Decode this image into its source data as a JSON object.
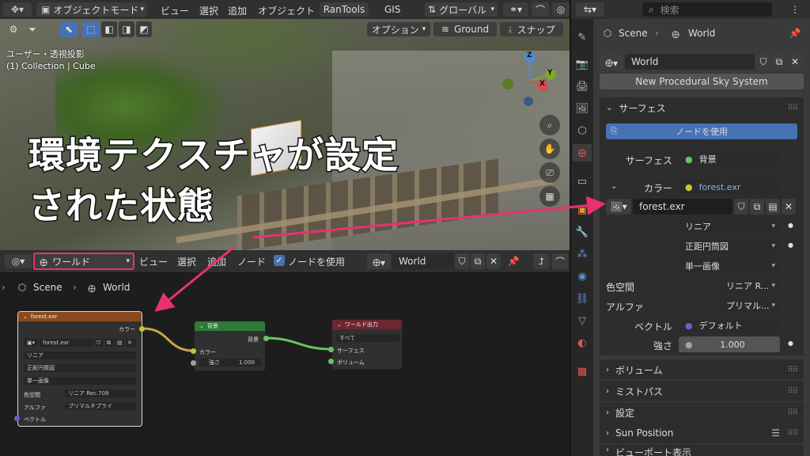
{
  "viewport_header": {
    "mode": "オブジェクトモード",
    "menus": [
      "ビュー",
      "選択",
      "追加",
      "オブジェクト"
    ],
    "addons": [
      "RanTools",
      "GIS"
    ],
    "transform_orientation": "グローバル"
  },
  "viewport_toolbar": {
    "options": "オプション",
    "ground": "Ground",
    "snap": "スナップ"
  },
  "viewport": {
    "view_name": "ユーザー・透視投影",
    "collection_info": "(1) Collection | Cube",
    "overlay_text_line1": "環境テクスチャが設定",
    "overlay_text_line2": "された状態",
    "gizmo_axes": [
      "Z",
      "Y",
      "X"
    ]
  },
  "node_editor_header": {
    "shader_type": "ワールド",
    "menus": [
      "ビュー",
      "選択",
      "追加",
      "ノード"
    ],
    "use_nodes": "ノードを使用",
    "world_name": "World"
  },
  "node_breadcrumb": {
    "scene": "Scene",
    "world": "World"
  },
  "nodes": {
    "env_texture": {
      "title": "forest.exr",
      "output_color": "カラー",
      "image": "forest.exr",
      "interpolation": "リニア",
      "projection": "正距円筒図",
      "extension": "単一画像",
      "color_space_label": "色空間",
      "color_space": "リニア Rec.709",
      "alpha_label": "アルファ",
      "alpha": "プリマルチプライ",
      "vector": "ベクトル"
    },
    "background": {
      "title": "背景",
      "output": "背景",
      "color": "カラー",
      "strength_label": "強さ",
      "strength": "1.000"
    },
    "world_output": {
      "title": "ワールド出力",
      "target": "すべて",
      "surface": "サーフェス",
      "volume": "ボリューム"
    }
  },
  "properties": {
    "search_placeholder": "検索",
    "breadcrumb_scene": "Scene",
    "breadcrumb_world": "World",
    "world_name": "World",
    "sky_button": "New Procedural Sky System",
    "surface_panel": "サーフェス",
    "use_nodes_button": "ノードを使用",
    "surface_label": "サーフェス",
    "surface_value": "背景",
    "color_label": "カラー",
    "color_value": "forest.exr",
    "image_name": "forest.exr",
    "interpolation": "リニア",
    "projection": "正距円筒図",
    "extension": "単一画像",
    "color_space_label": "色空間",
    "color_space": "リニア R...",
    "alpha_label": "アルファ",
    "alpha": "プリマル...",
    "vector_label": "ベクトル",
    "vector_value": "デフォルト",
    "strength_label": "強さ",
    "strength_value": "1.000",
    "panels": [
      "ボリューム",
      "ミストパス",
      "設定",
      "Sun Position",
      "ビューポート表示"
    ]
  },
  "colors": {
    "accent_blue": "#4772b3",
    "highlight_pink": "#e8326e",
    "node_texture_header": "#8b4a1e",
    "node_shader_header": "#2f7a3a",
    "node_output_header": "#6e2630",
    "socket_yellow": "#c7c729",
    "socket_green": "#63c763",
    "socket_purple": "#6363c7",
    "socket_grey": "#a1a1a1"
  }
}
